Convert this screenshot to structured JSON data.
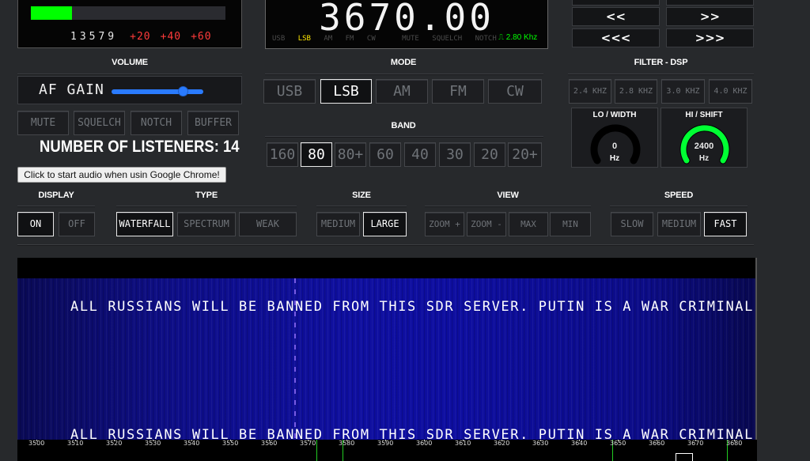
{
  "smeter": {
    "level": 0.21,
    "scale_white": "13579",
    "scale_red": [
      "+20",
      "+40",
      "+60"
    ]
  },
  "freq": {
    "value": "3670.00",
    "modes": [
      "USB",
      "LSB",
      "AM",
      "FM",
      "CW"
    ],
    "active_mode_indicator": "LSB",
    "mute": "MUTE",
    "squelch": "SQUELCH",
    "notch": "NOTCH",
    "bandwidth": "2.80 Khz"
  },
  "tune": {
    "fine_down": "<<",
    "fine_up": ">>",
    "coarse_down": "<<<",
    "coarse_up": ">>>"
  },
  "volume": {
    "label": "VOLUME",
    "af_gain": "AF GAIN",
    "af_gain_level": 0.78,
    "buttons": [
      "MUTE",
      "SQUELCH",
      "NOTCH",
      "BUFFER"
    ]
  },
  "mode": {
    "label": "MODE",
    "buttons": [
      "USB",
      "LSB",
      "AM",
      "FM",
      "CW"
    ],
    "active": "LSB"
  },
  "band": {
    "label": "BAND",
    "buttons": [
      "160",
      "80",
      "80+",
      "60",
      "40",
      "30",
      "20",
      "20+"
    ],
    "active": "80"
  },
  "filter": {
    "label": "FILTER - DSP",
    "buttons": [
      "2.4 KHZ",
      "2.8 KHZ",
      "3.0 KHZ",
      "4.0 KHZ"
    ],
    "lo_width": {
      "title": "LO / WIDTH",
      "value": "0",
      "unit": "Hz",
      "color": "#ffffff"
    },
    "hi_shift": {
      "title": "HI / SHIFT",
      "value": "2400",
      "unit": "Hz",
      "color": "#00ff33"
    }
  },
  "listeners": {
    "text": "NUMBER OF LISTENERS: 14"
  },
  "chrome_button": "Click to start audio when usin Google Chrome!",
  "display": {
    "label": "DISPLAY",
    "buttons": [
      "ON",
      "OFF"
    ],
    "active": "ON"
  },
  "type": {
    "label": "TYPE",
    "buttons": [
      "WATERFALL",
      "SPECTRUM",
      "WEAK"
    ],
    "active": "WATERFALL"
  },
  "size": {
    "label": "SIZE",
    "buttons": [
      "MEDIUM",
      "LARGE"
    ],
    "active": "LARGE"
  },
  "view": {
    "label": "VIEW",
    "buttons": [
      "ZOOM +",
      "ZOOM -",
      "MAX",
      "MIN"
    ]
  },
  "speed": {
    "label": "SPEED",
    "buttons": [
      "SLOW",
      "MEDIUM",
      "FAST"
    ],
    "active": "FAST"
  },
  "waterfall": {
    "banner_1": "ALL RUSSIANS WILL BE BANNED FROM THIS SDR SERVER. PUTIN IS A WAR CRIMINAL",
    "banner_2": "ALL RUSSIANS WILL BE BANNED FROM THIS SDR SERVER. PUTIN IS A WAR CRIMINAL"
  },
  "scale": {
    "ticks": [
      "3500",
      "3510",
      "3520",
      "3530",
      "3540",
      "3550",
      "3560",
      "3570",
      "3580",
      "3590",
      "3600",
      "3610",
      "3620",
      "3630",
      "3640",
      "3650",
      "3660",
      "3670",
      "3680"
    ]
  },
  "colors": {
    "accent_green": "#00ff00",
    "slider_blue": "#2a7bff",
    "mode_yellow": "#ffe700",
    "smeter_red": "#ff3b3b"
  }
}
